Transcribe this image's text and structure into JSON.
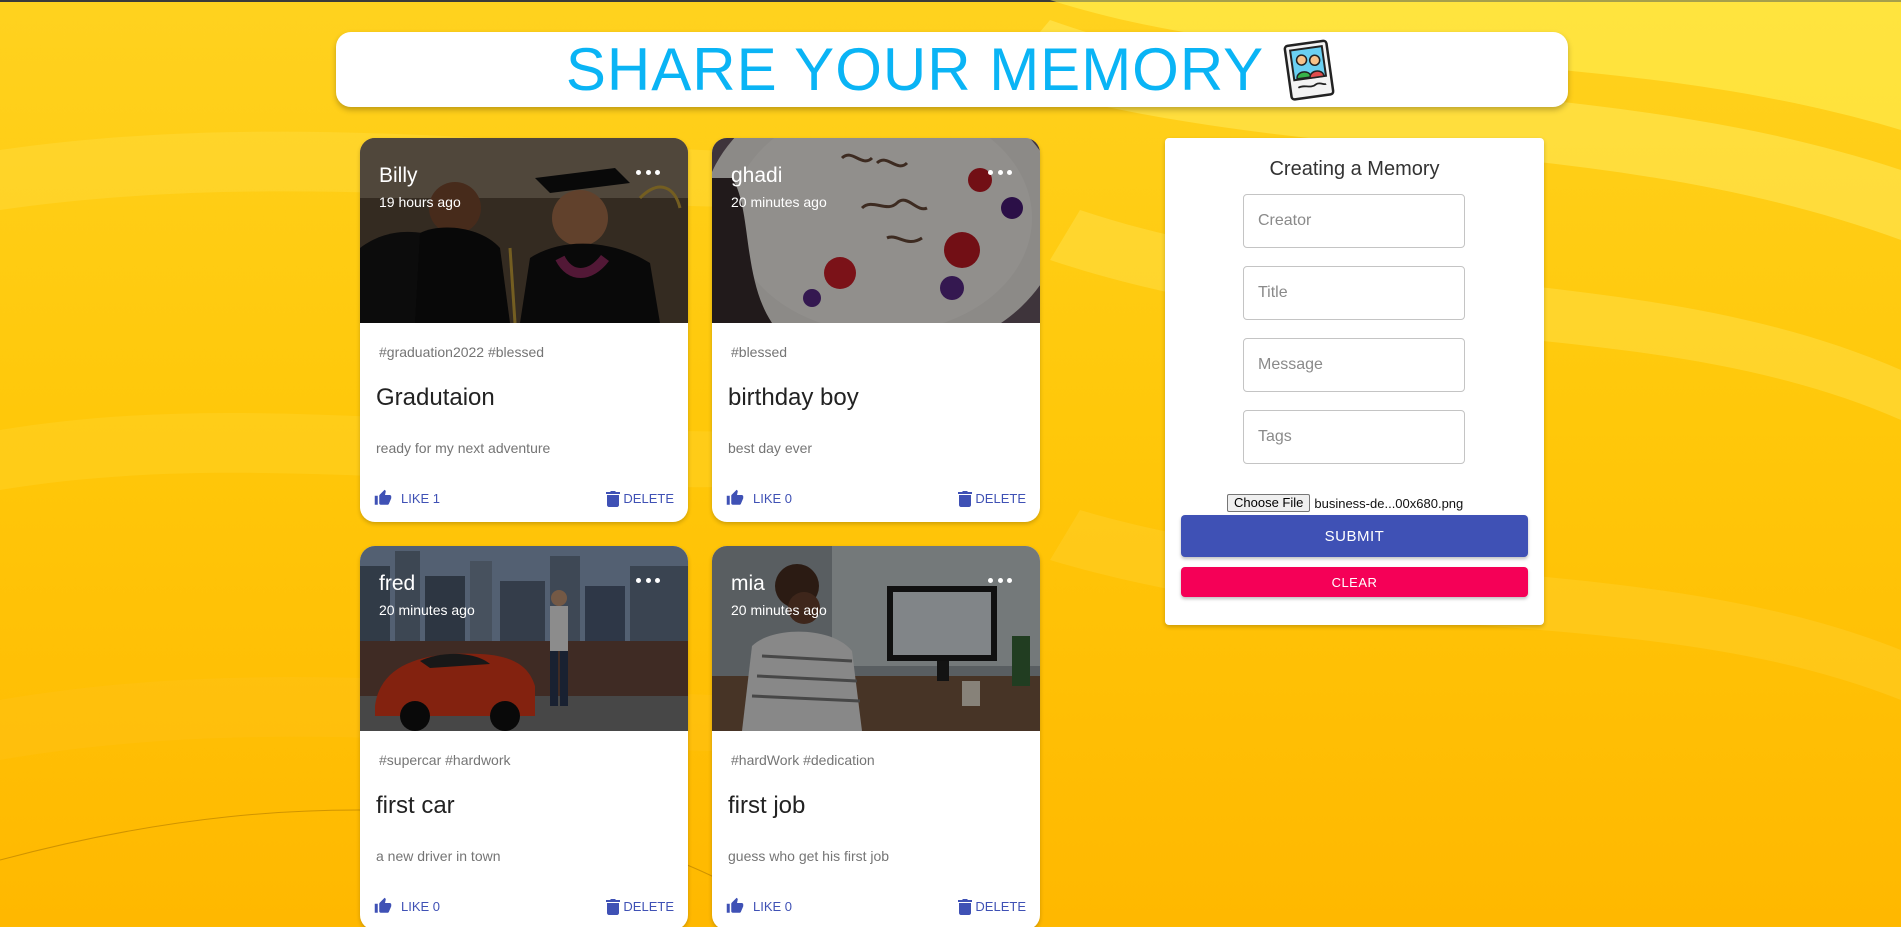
{
  "app": {
    "title": "SHARE YOUR MEMORY",
    "logo_icon": "photo-frame-people-icon",
    "accent_color": "#0ab4f5",
    "background_color": "#ffc80a"
  },
  "posts": [
    {
      "creator": "Billy",
      "time": "19 hours ago",
      "tags": "#graduation2022 #blessed",
      "title": "Gradutaion",
      "message": "ready for my next adventure",
      "like_label": "LIKE 1",
      "delete_label": "DELETE",
      "image_subject": "graduation photo"
    },
    {
      "creator": "ghadi",
      "time": "20 minutes ago",
      "tags": "#blessed",
      "title": "birthday boy",
      "message": "best day ever",
      "like_label": "LIKE 0",
      "delete_label": "DELETE",
      "image_subject": "birthday cake photo"
    },
    {
      "creator": "fred",
      "time": "20 minutes ago",
      "tags": "#supercar #hardwork",
      "title": "first car",
      "message": "a new driver in town",
      "like_label": "LIKE 0",
      "delete_label": "DELETE",
      "image_subject": "red sports car photo"
    },
    {
      "creator": "mia",
      "time": "20 minutes ago",
      "tags": "#hardWork #dedication",
      "title": "first job",
      "message": "guess who get his first job",
      "like_label": "LIKE 0",
      "delete_label": "DELETE",
      "image_subject": "office desk photo"
    }
  ],
  "form": {
    "heading": "Creating a Memory",
    "creator_placeholder": "Creator",
    "title_placeholder": "Title",
    "message_placeholder": "Message",
    "tags_placeholder": "Tags",
    "choose_file_label": "Choose File",
    "file_name": "business-de...00x680.png",
    "submit_label": "SUBMIT",
    "clear_label": "CLEAR",
    "submit_color": "#3f51b5",
    "clear_color": "#f50057"
  },
  "icons": {
    "more": "more-horizontal-icon",
    "like": "thumb-up-icon",
    "delete": "trash-icon"
  }
}
